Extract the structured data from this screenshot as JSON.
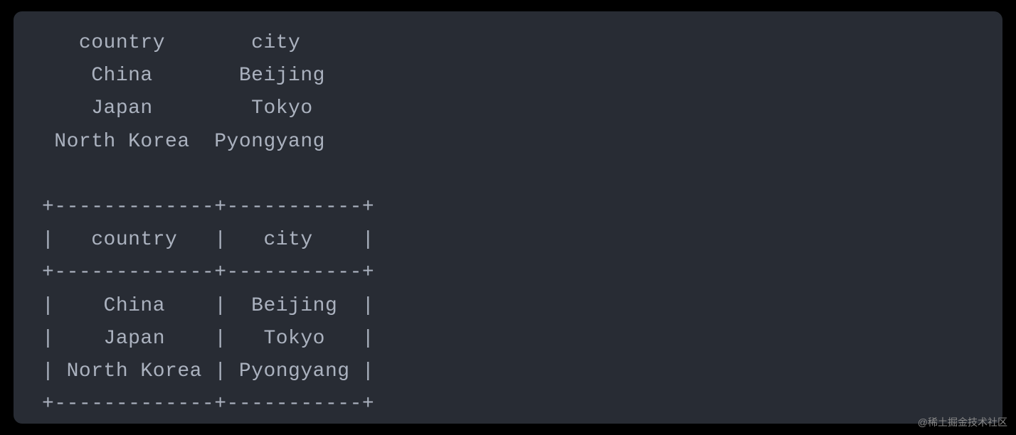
{
  "simple_table": {
    "headers": [
      "country",
      "city"
    ],
    "rows": [
      [
        "China",
        "Beijing"
      ],
      [
        "Japan",
        "Tokyo"
      ],
      [
        "North Korea",
        "Pyongyang"
      ]
    ]
  },
  "bordered_table": {
    "headers": [
      "country",
      "city"
    ],
    "rows": [
      [
        "China",
        "Beijing"
      ],
      [
        "Japan",
        "Tokyo"
      ],
      [
        "North Korea",
        "Pyongyang"
      ]
    ]
  },
  "watermark": "@稀土掘金技术社区",
  "rendered": {
    "simple_line_header": "   country       city",
    "simple_line_1": "    China       Beijing",
    "simple_line_2": "    Japan        Tokyo",
    "simple_line_3": " North Korea  Pyongyang",
    "border_top": "+-------------+-----------+",
    "border_header": "|   country   |   city    |",
    "border_sep": "+-------------+-----------+",
    "border_row_1": "|    China    |  Beijing  |",
    "border_row_2": "|    Japan    |   Tokyo   |",
    "border_row_3": "| North Korea | Pyongyang |",
    "border_bottom": "+-------------+-----------+"
  }
}
